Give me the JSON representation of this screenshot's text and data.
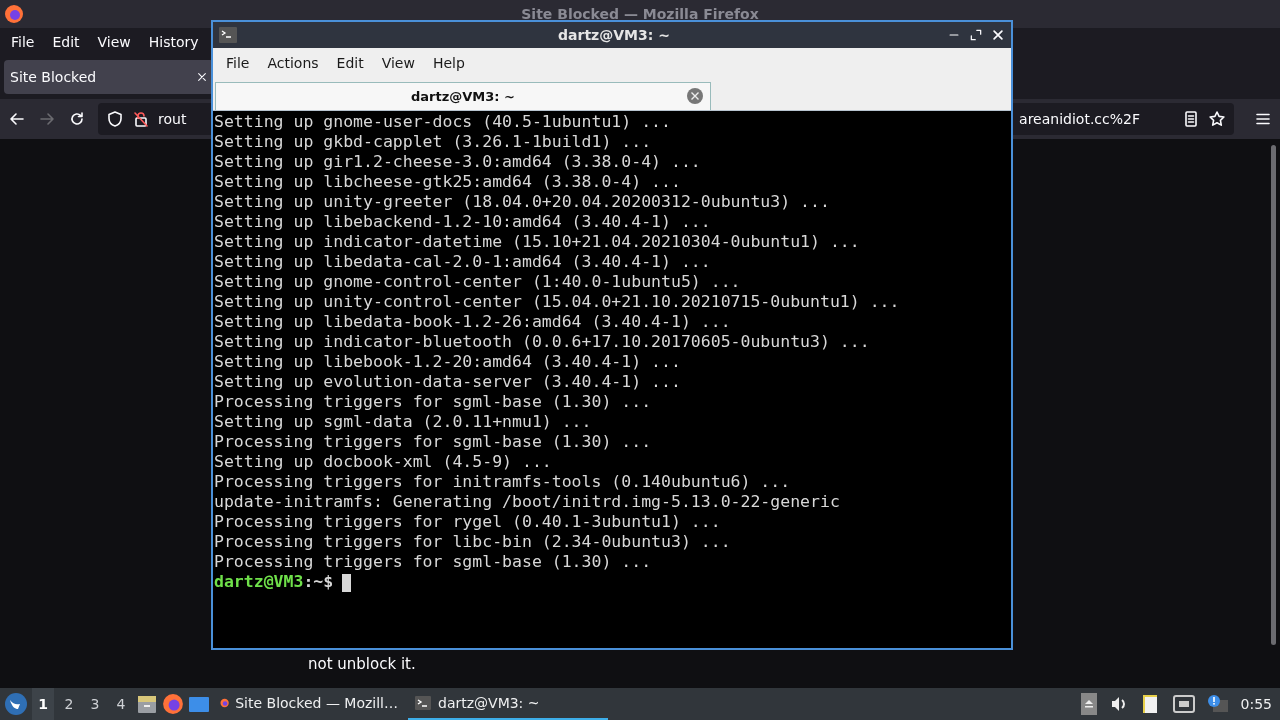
{
  "firefox": {
    "title": "Site Blocked — Mozilla Firefox",
    "menu": [
      "File",
      "Edit",
      "View",
      "History"
    ],
    "tab": {
      "title": "Site Blocked",
      "selected": true
    },
    "url_start": "rout",
    "url_end": "areanidiot.cc%2F",
    "page_text": "not unblock it."
  },
  "terminal": {
    "title": "dartz@VM3: ~",
    "menu": [
      "File",
      "Actions",
      "Edit",
      "View",
      "Help"
    ],
    "tab": {
      "label": "dartz@VM3: ~",
      "selected": true
    },
    "lines": [
      "Setting up gnome-user-docs (40.5-1ubuntu1) ...",
      "Setting up gkbd-capplet (3.26.1-1build1) ...",
      "Setting up gir1.2-cheese-3.0:amd64 (3.38.0-4) ...",
      "Setting up libcheese-gtk25:amd64 (3.38.0-4) ...",
      "Setting up unity-greeter (18.04.0+20.04.20200312-0ubuntu3) ...",
      "Setting up libebackend-1.2-10:amd64 (3.40.4-1) ...",
      "Setting up indicator-datetime (15.10+21.04.20210304-0ubuntu1) ...",
      "Setting up libedata-cal-2.0-1:amd64 (3.40.4-1) ...",
      "Setting up gnome-control-center (1:40.0-1ubuntu5) ...",
      "Setting up unity-control-center (15.04.0+21.10.20210715-0ubuntu1) ...",
      "Setting up libedata-book-1.2-26:amd64 (3.40.4-1) ...",
      "Setting up indicator-bluetooth (0.0.6+17.10.20170605-0ubuntu3) ...",
      "Setting up libebook-1.2-20:amd64 (3.40.4-1) ...",
      "Setting up evolution-data-server (3.40.4-1) ...",
      "Processing triggers for sgml-base (1.30) ...",
      "Setting up sgml-data (2.0.11+nmu1) ...",
      "Processing triggers for sgml-base (1.30) ...",
      "Setting up docbook-xml (4.5-9) ...",
      "Processing triggers for initramfs-tools (0.140ubuntu6) ...",
      "update-initramfs: Generating /boot/initrd.img-5.13.0-22-generic",
      "Processing triggers for rygel (0.40.1-3ubuntu1) ...",
      "Processing triggers for libc-bin (2.34-0ubuntu3) ...",
      "Processing triggers for sgml-base (1.30) ..."
    ],
    "prompt_user": "dartz@VM3",
    "prompt_rest": ":~$"
  },
  "taskbar": {
    "desktops": [
      {
        "label": "1",
        "selected": true
      },
      {
        "label": "2",
        "selected": false
      },
      {
        "label": "3",
        "selected": false
      },
      {
        "label": "4",
        "selected": false
      }
    ],
    "tasks": [
      {
        "kind": "firefox",
        "label": "Site Blocked — Mozill…",
        "selected": false
      },
      {
        "kind": "terminal",
        "label": "dartz@VM3: ~",
        "selected": true
      }
    ],
    "clock": "0:55"
  }
}
